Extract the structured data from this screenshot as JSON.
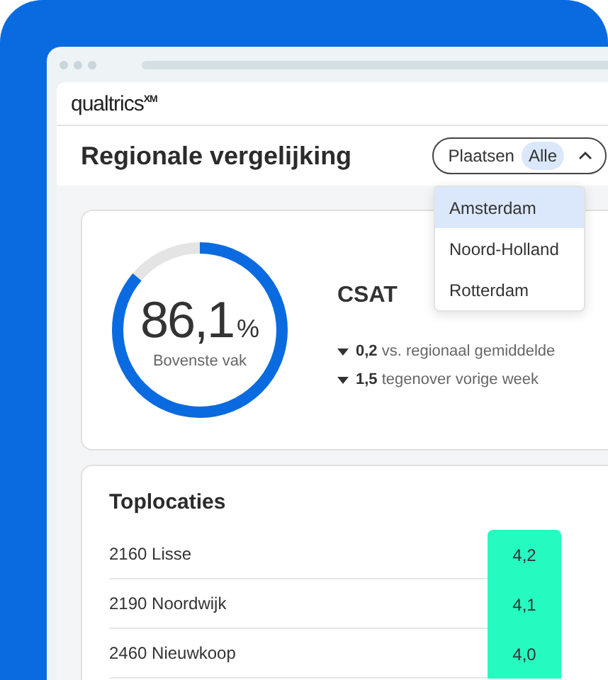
{
  "app": {
    "logo": "qualtrics$^{XM}$"
  },
  "header": {
    "title": "Regionale vergelijking"
  },
  "filter": {
    "label": "Plaatsen",
    "value": "Alle",
    "expanded": true,
    "options": [
      {
        "label": "Amsterdam",
        "selected": true
      },
      {
        "label": "Noord-Holland",
        "selected": false
      },
      {
        "label": "Rotterdam",
        "selected": false
      }
    ]
  },
  "score_card": {
    "value": "86,1",
    "unit": "%",
    "caption": "Bovenste vak",
    "level": 0.861,
    "metric": "CSAT",
    "deltas": [
      {
        "kind": "down",
        "text": "**0,2** vs. regionaal gemiddelde"
      },
      {
        "kind": "down",
        "text": "**1,5** tegenover vorige week"
      }
    ]
  },
  "top_locations": {
    "title": "Toplocaties",
    "rows": [
      {
        "name": "2160 Lisse",
        "score": "4,2"
      },
      {
        "name": "2190 Noordwijk",
        "score": "4,1"
      },
      {
        "name": "2460 Nieuwkoop",
        "score": "4,0"
      }
    ]
  }
}
